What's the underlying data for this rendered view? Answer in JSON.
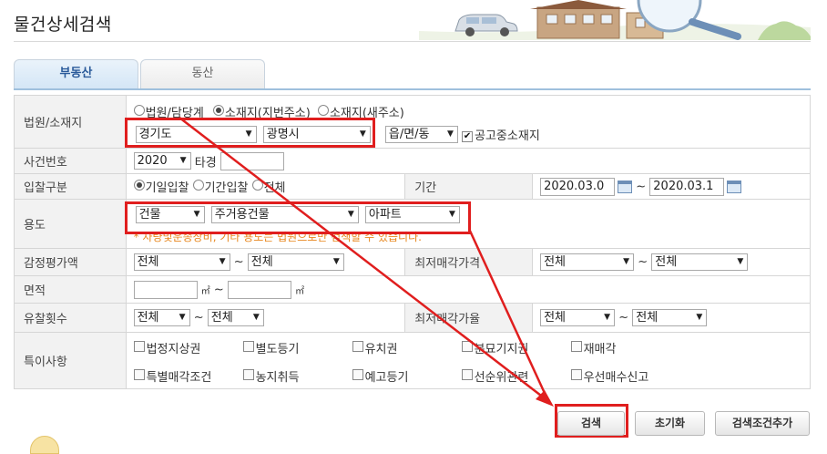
{
  "page": {
    "title": "물건상세검색"
  },
  "tabs": [
    {
      "label": "부동산",
      "active": true
    },
    {
      "label": "동산",
      "active": false
    }
  ],
  "court_location": {
    "label": "법원/소재지",
    "radios": [
      {
        "label": "법원/담당계",
        "checked": false
      },
      {
        "label": "소재지(지번주소)",
        "checked": true
      },
      {
        "label": "소재지(새주소)",
        "checked": false
      }
    ],
    "province": "경기도",
    "city": "광명시",
    "town": "읍/면/동",
    "public_location_label": "공고중소재지",
    "public_location_checked": true
  },
  "case_number": {
    "label": "사건번호",
    "year": "2020",
    "type_label": "타경",
    "number": ""
  },
  "bid_type": {
    "label": "입찰구분",
    "radios": [
      {
        "label": "기일입찰",
        "checked": true
      },
      {
        "label": "기간입찰",
        "checked": false
      },
      {
        "label": "전체",
        "checked": false
      }
    ],
    "period_label": "기간",
    "date_from": "2020.03.0",
    "date_sep": "~",
    "date_to": "2020.03.1"
  },
  "usage": {
    "label": "용도",
    "category1": "건물",
    "category2": "주거용건물",
    "category3": "아파트",
    "note": "* 차량및운송장비, 기타 용도는 법원으로만 검색할 수 있습니다."
  },
  "appraisal": {
    "label": "감정평가액",
    "from": "전체",
    "sep": "~",
    "to": "전체"
  },
  "min_price": {
    "label": "최저매각가격",
    "from": "전체",
    "sep": "~",
    "to": "전체"
  },
  "area": {
    "label": "면적",
    "unit": "㎡",
    "sep": "~"
  },
  "failed_count": {
    "label": "유찰횟수",
    "from": "전체",
    "sep": "~",
    "to": "전체"
  },
  "min_rate": {
    "label": "최저매각가율",
    "from": "전체",
    "sep": "~",
    "to": "전체"
  },
  "special": {
    "label": "특이사항",
    "items": [
      "법정지상권",
      "별도등기",
      "유치권",
      "분묘기지권",
      "재매각",
      "특별매각조건",
      "농지취득",
      "예고등기",
      "선순위관련",
      "우선매수신고"
    ]
  },
  "buttons": {
    "search": "검색",
    "reset": "초기화",
    "add_condition": "검색조건추가"
  },
  "colors": {
    "highlight": "#e01e1e",
    "tab_active_text": "#2a5a9a",
    "note": "#e8871e"
  }
}
